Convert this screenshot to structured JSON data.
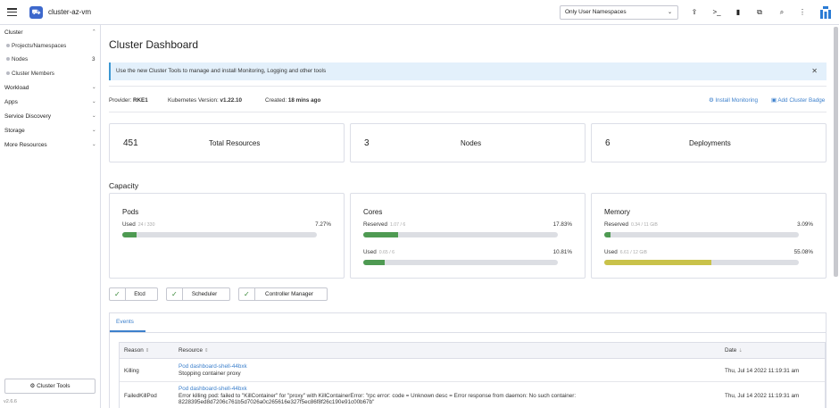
{
  "header": {
    "cluster_name": "cluster-az-vm",
    "namespace_select": "Only User Namespaces",
    "icons": [
      "hamburger-icon",
      "cluster-icon",
      "upload-icon",
      "terminal-icon",
      "file-icon",
      "copy-icon",
      "search-icon",
      "more-icon",
      "rancher-logo"
    ]
  },
  "sidebar": {
    "cluster_group": "Cluster",
    "items": [
      {
        "label": "Projects/Namespaces"
      },
      {
        "label": "Nodes",
        "count": "3"
      },
      {
        "label": "Cluster Members"
      }
    ],
    "groups": [
      "Workload",
      "Apps",
      "Service Discovery",
      "Storage",
      "More Resources"
    ],
    "cluster_tools": "Cluster Tools",
    "version": "v2.6.6"
  },
  "main": {
    "title": "Cluster Dashboard",
    "banner": "Use the new Cluster Tools to manage and install Monitoring, Logging and other tools",
    "provider_label": "Provider:",
    "provider_value": "RKE1",
    "k8s_label": "Kubernetes Version:",
    "k8s_value": "v1.22.10",
    "created_label": "Created:",
    "created_value": "18 mins ago",
    "install_monitoring": "Install Monitoring",
    "add_badge": "Add Cluster Badge",
    "stats": [
      {
        "value": "451",
        "label": "Total Resources"
      },
      {
        "value": "3",
        "label": "Nodes"
      },
      {
        "value": "6",
        "label": "Deployments"
      }
    ],
    "capacity_title": "Capacity",
    "pods": {
      "title": "Pods",
      "used_label": "Used",
      "used_sub": "24 / 330",
      "used_pct": "7.27%",
      "used_frac": 0.0727
    },
    "cores": {
      "title": "Cores",
      "reserved_label": "Reserved",
      "reserved_sub": "1.07 / 6",
      "reserved_pct": "17.83%",
      "reserved_frac": 0.1783,
      "used_label": "Used",
      "used_sub": "0.65 / 6",
      "used_pct": "10.81%",
      "used_frac": 0.1081
    },
    "memory": {
      "title": "Memory",
      "reserved_label": "Reserved",
      "reserved_sub": "0.34 / 11 GiB",
      "reserved_pct": "3.09%",
      "reserved_frac": 0.0309,
      "used_label": "Used",
      "used_sub": "6.61 / 12 GiB",
      "used_pct": "55.08%",
      "used_frac": 0.5508
    },
    "components": [
      "Etcd",
      "Scheduler",
      "Controller Manager"
    ],
    "events_tab": "Events",
    "table_headers": {
      "reason": "Reason",
      "resource": "Resource",
      "date": "Date"
    },
    "events": [
      {
        "reason": "Killing",
        "resource": "Pod dashboard-shell-44bxk",
        "message": "Stopping container proxy",
        "message2": "",
        "date": "Thu, Jul 14 2022  11:19:31 am"
      },
      {
        "reason": "FailedKillPod",
        "resource": "Pod dashboard-shell-44bxk",
        "message": "Error killing pod: failed to \"KillContainer\" for \"proxy\" with KillContainerError: \"rpc error: code = Unknown desc = Error response from daemon: No such container:",
        "message2": "8228395ed8d7206c761b5d7026a0c265616e327f5ec86f8f26c190e91c00b67b\"",
        "date": "Thu, Jul 14 2022  11:19:31 am"
      }
    ]
  },
  "colors": {
    "accent": "#3d68cc",
    "green": "#4e9a52",
    "yellow": "#c9c24a",
    "link": "#3d80cc"
  }
}
